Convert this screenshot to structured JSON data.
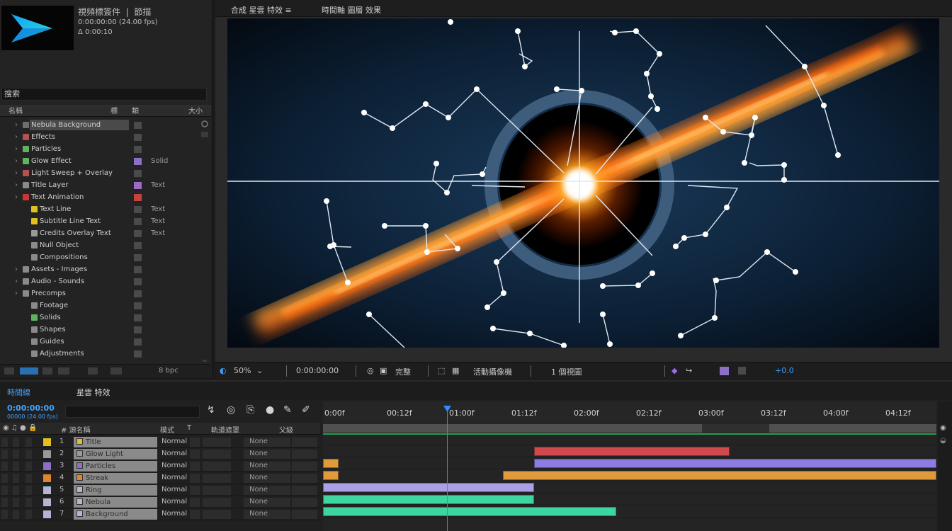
{
  "project": {
    "title": "視頻標簽件",
    "title2": "節描",
    "info1": "0:00:00:00 (24.00 fps)",
    "info2": "Δ 0:00:10",
    "search": "搜索",
    "header": {
      "name": "名稱",
      "label": "標",
      "type": "類",
      "size": "大小"
    },
    "items": [
      {
        "name": "Nebula Background",
        "type": "",
        "icon_color": "#6d6d6d",
        "label_color": "#4b4b4b",
        "indent": 0,
        "selected": true
      },
      {
        "name": "Effects",
        "type": "",
        "icon_color": "#b85050",
        "label_color": "#4b4b4b",
        "indent": 0
      },
      {
        "name": "Particles",
        "type": "",
        "icon_color": "#5fb35f",
        "label_color": "#4b4b4b",
        "indent": 0
      },
      {
        "name": "Glow Effect",
        "type": "Solid",
        "icon_color": "#5fb35f",
        "label_color": "#8d6fc8",
        "indent": 0
      },
      {
        "name": "Light Sweep + Overlay",
        "type": "",
        "icon_color": "#b85050",
        "label_color": "#4b4b4b",
        "indent": 0
      },
      {
        "name": "Title Layer",
        "type": "Text",
        "icon_color": "#8a8a8a",
        "label_color": "#9a6bc8",
        "indent": 0
      },
      {
        "name": "Text Animation",
        "type": "",
        "icon_color": "#cc3333",
        "label_color": "#c94040",
        "indent": 0
      },
      {
        "name": "Text Line",
        "type": "Text",
        "icon_color": "#e0c020",
        "label_color": "#4b4b4b",
        "indent": 1
      },
      {
        "name": "Subtitle Line Text",
        "type": "Text",
        "icon_color": "#e0c020",
        "label_color": "#4b4b4b",
        "indent": 1
      },
      {
        "name": "Credits Overlay Text",
        "type": "Text",
        "icon_color": "#9a9a9a",
        "label_color": "#4b4b4b",
        "indent": 1
      },
      {
        "name": "Null Object",
        "type": "",
        "icon_color": "#8a8a8a",
        "label_color": "#4b4b4b",
        "indent": 1
      },
      {
        "name": "Compositions",
        "type": "",
        "icon_color": "#8a8a8a",
        "label_color": "#4b4b4b",
        "indent": 1
      },
      {
        "name": "Assets - Images",
        "type": "",
        "icon_color": "#8a8a8a",
        "label_color": "#4b4b4b",
        "indent": 0
      },
      {
        "name": "Audio - Sounds",
        "type": "",
        "icon_color": "#8a8a8a",
        "label_color": "#4b4b4b",
        "indent": 0
      },
      {
        "name": "Precomps",
        "type": "",
        "icon_color": "#8a8a8a",
        "label_color": "#4b4b4b",
        "indent": 0
      },
      {
        "name": "Footage",
        "type": "",
        "icon_color": "#8a8a8a",
        "label_color": "#4b4b4b",
        "indent": 1
      },
      {
        "name": "Solids",
        "type": "",
        "icon_color": "#5fb35f",
        "label_color": "#4b4b4b",
        "indent": 1
      },
      {
        "name": "Shapes",
        "type": "",
        "icon_color": "#8a8a8a",
        "label_color": "#4b4b4b",
        "indent": 1
      },
      {
        "name": "Guides",
        "type": "",
        "icon_color": "#8a8a8a",
        "label_color": "#4b4b4b",
        "indent": 1
      },
      {
        "name": "Adjustments",
        "type": "",
        "icon_color": "#8a8a8a",
        "label_color": "#4b4b4b",
        "indent": 1
      }
    ],
    "footer_bpc": "8 bpc"
  },
  "viewer": {
    "tab1": "合成 星雲 特效 ≡",
    "tab2": "時間軸 圖層 效果"
  },
  "viewer_toolbar": {
    "zoom": "50%",
    "time": "0:00:00:00",
    "quality": "完整",
    "view": "活動攝像機",
    "views": "1 個視圖",
    "exposure": "+0.0"
  },
  "timeline": {
    "tab1": "時間線",
    "tab2": "星雲 特效",
    "current_time": "0:00:00:00",
    "current_time_sub": "00000 (24.00 fps)",
    "search": "",
    "col_header": {
      "source": "#  源名稱",
      "mode": "模式",
      "t": "T",
      "trkmat": "軌道遮罩",
      "parent": "父級"
    },
    "ruler_labels": [
      "0:00f",
      "00:12f",
      "01:00f",
      "01:12f",
      "02:00f",
      "02:12f",
      "03:00f",
      "03:12f",
      "04:00f",
      "04:12f"
    ],
    "layers": [
      {
        "num": "1",
        "name": "Title",
        "mode": "Normal",
        "parent": "None",
        "color": "#e0c020"
      },
      {
        "num": "2",
        "name": "Glow Light",
        "mode": "Normal",
        "parent": "None",
        "color": "#9a9a9a"
      },
      {
        "num": "3",
        "name": "Particles",
        "mode": "Normal",
        "parent": "None",
        "color": "#8d6fc8"
      },
      {
        "num": "4",
        "name": "Streak",
        "mode": "Normal",
        "parent": "None",
        "color": "#e0862a"
      },
      {
        "num": "5",
        "name": "Ring",
        "mode": "Normal",
        "parent": "None",
        "color": "#b4b4d4"
      },
      {
        "num": "6",
        "name": "Nebula",
        "mode": "Normal",
        "parent": "None",
        "color": "#b4b4d4"
      },
      {
        "num": "7",
        "name": "Background",
        "mode": "Normal",
        "parent": "None",
        "color": "#b4b4d4"
      }
    ]
  },
  "colors": {
    "accent": "#2f8bff",
    "clip_red": "#d0494e",
    "clip_purple": "#8d7ce0",
    "clip_orange": "#e09a3c",
    "clip_lavender": "#a9a0e6",
    "clip_teal": "#3ed6a0"
  }
}
